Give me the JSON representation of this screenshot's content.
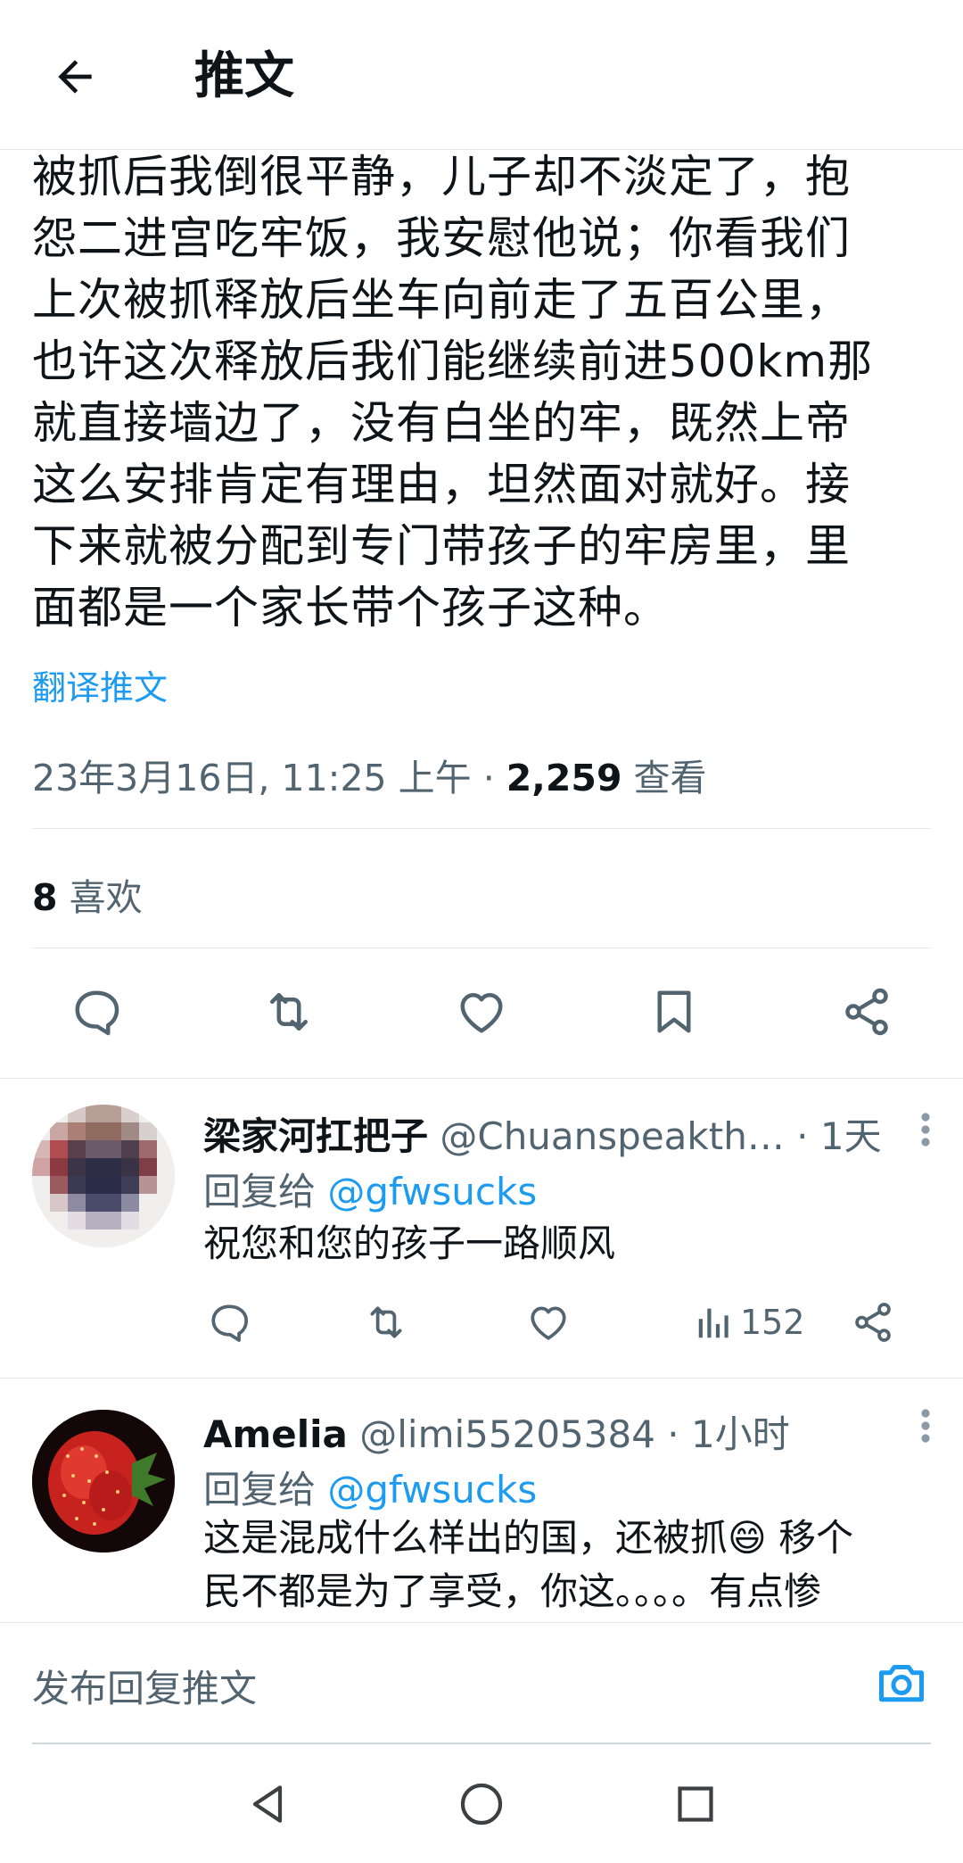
{
  "header": {
    "title": "推文"
  },
  "tweet": {
    "lines": [
      "被抓后我倒很平静，儿子却不淡定了，抱",
      "怨二进宫吃牢饭，我安慰他说；你看我们",
      "上次被抓释放后坐车向前走了五百公里，",
      "也许这次释放后我们能继续前进500km那",
      "就直接墙边了，没有白坐的牢，既然上帝",
      "这么安排肯定有理由，坦然面对就好。接",
      "下来就被分配到专门带孩子的牢房里，里",
      "面都是一个家长带个孩子这种。"
    ],
    "translate": "翻译推文",
    "timestamp": "23年3月16日, 11:25 上午 · ",
    "views": "2,259",
    "views_label": " 查看",
    "likes": "8",
    "likes_label": " 喜欢"
  },
  "replies": [
    {
      "name": "梁家河扛把子",
      "handle": " @Chuanspeakth…",
      "time": " · 1天",
      "reply_to_label": "回复给 ",
      "reply_to_handle": "@gfwsucks",
      "text": "祝您和您的孩子一路顺风",
      "views": "152"
    },
    {
      "name": "Amelia",
      "handle": " @limi55205384",
      "time": " · 1小时",
      "reply_to_label": "回复给 ",
      "reply_to_handle": "@gfwsucks",
      "text_line1": "这是混成什么样出的国，还被抓😄 移个",
      "text_line2": "民不都是为了享受，你这。。。。有点惨"
    }
  ],
  "compose": {
    "placeholder": "发布回复推文"
  },
  "colors": {
    "accent": "#1d9bf0",
    "secondary_text": "#536471",
    "primary_text": "#0f1419",
    "divider": "#e6e8ea"
  },
  "icons": {
    "back": "arrow-left-icon",
    "reply": "comment-icon",
    "retweet": "retweet-icon",
    "like": "heart-icon",
    "bookmark": "bookmark-icon",
    "share": "share-icon",
    "views": "bar-chart-icon",
    "more": "more-vertical-icon",
    "camera": "camera-icon",
    "nav_back": "triangle-back-icon",
    "nav_home": "circle-home-icon",
    "nav_recents": "square-recents-icon"
  }
}
